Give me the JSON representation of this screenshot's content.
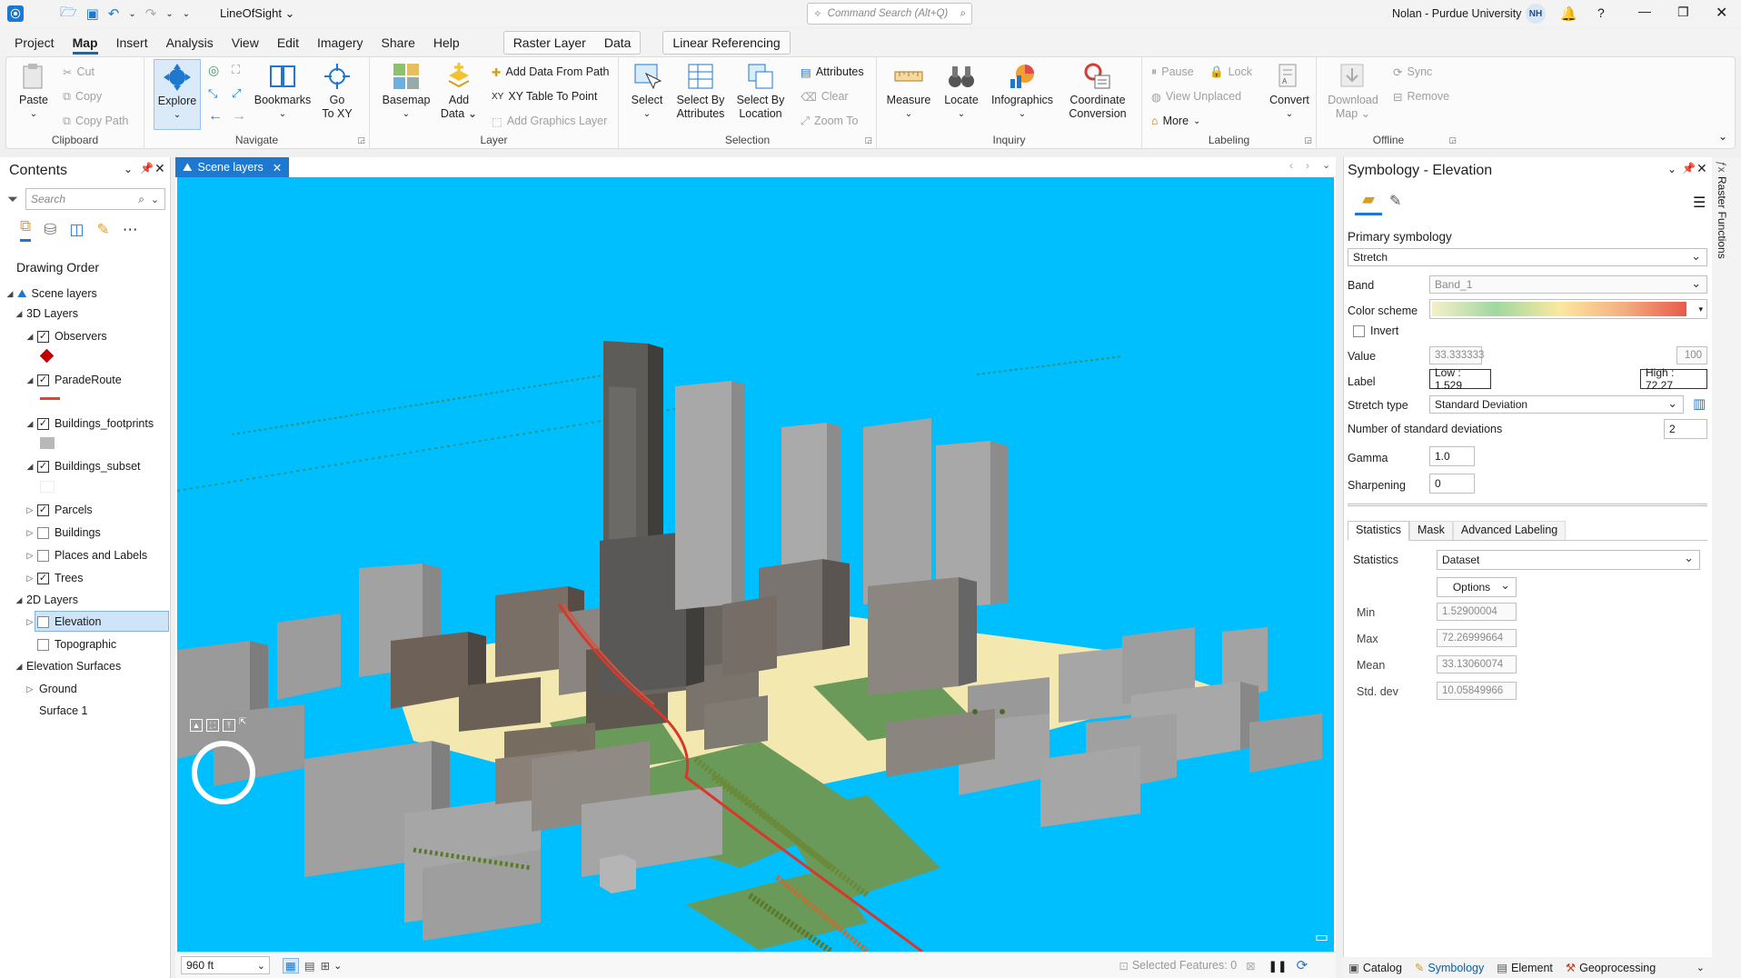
{
  "titlebar": {
    "project_name": "LineOfSight",
    "command_search_placeholder": "Command Search (Alt+Q)",
    "user": "Nolan - Purdue University",
    "user_initials": "NH",
    "help": "?"
  },
  "menu": {
    "tabs": [
      "Project",
      "Map",
      "Insert",
      "Analysis",
      "View",
      "Edit",
      "Imagery",
      "Share",
      "Help"
    ],
    "active_tab": "Map",
    "contextual": [
      "Raster Layer",
      "Data"
    ],
    "linear_referencing": "Linear Referencing"
  },
  "ribbon": {
    "clipboard": {
      "label": "Clipboard",
      "paste": "Paste",
      "cut": "Cut",
      "copy": "Copy",
      "copy_path": "Copy Path"
    },
    "navigate": {
      "label": "Navigate",
      "explore": "Explore",
      "bookmarks": "Bookmarks",
      "go_to_xy_line1": "Go",
      "go_to_xy_line2": "To XY"
    },
    "layer": {
      "label": "Layer",
      "basemap": "Basemap",
      "add_data_line1": "Add",
      "add_data_line2": "Data",
      "add_data_from_path": "Add Data From Path",
      "xy_table_to_point": "XY Table To Point",
      "add_graphics_layer": "Add Graphics Layer"
    },
    "selection": {
      "label": "Selection",
      "select": "Select",
      "select_by_attributes_l1": "Select By",
      "select_by_attributes_l2": "Attributes",
      "select_by_location_l1": "Select By",
      "select_by_location_l2": "Location",
      "attributes": "Attributes",
      "clear": "Clear",
      "zoom_to": "Zoom To"
    },
    "inquiry": {
      "label": "Inquiry",
      "measure": "Measure",
      "locate": "Locate",
      "infographics": "Infographics",
      "coordinate_l1": "Coordinate",
      "coordinate_l2": "Conversion"
    },
    "labeling": {
      "label": "Labeling",
      "pause": "Pause",
      "lock": "Lock",
      "view_unplaced": "View Unplaced",
      "more": "More",
      "convert": "Convert"
    },
    "offline": {
      "label": "Offline",
      "download_l1": "Download",
      "download_l2": "Map",
      "sync": "Sync",
      "remove": "Remove"
    }
  },
  "contents": {
    "title": "Contents",
    "search_placeholder": "Search",
    "drawing_order": "Drawing Order",
    "scene_layers": "Scene layers",
    "group_3d": "3D Layers",
    "observers": "Observers",
    "parade_route": "ParadeRoute",
    "buildings_footprints": "Buildings_footprints",
    "buildings_subset": "Buildings_subset",
    "parcels": "Parcels",
    "buildings": "Buildings",
    "places_and_labels": "Places and Labels",
    "trees": "Trees",
    "group_2d": "2D Layers",
    "elevation": "Elevation",
    "topographic": "Topographic",
    "elevation_surfaces": "Elevation Surfaces",
    "ground": "Ground",
    "surface_1": "Surface 1"
  },
  "map": {
    "tab_label": "Scene layers",
    "scale": "960 ft",
    "selected_features": "Selected Features: 0"
  },
  "symbology": {
    "title": "Symbology - Elevation",
    "primary_symbology": "Primary symbology",
    "renderer": "Stretch",
    "band_label": "Band",
    "band_value": "Band_1",
    "color_scheme_label": "Color scheme",
    "invert": "Invert",
    "value_label": "Value",
    "value_value": "33.333333",
    "value_max": "100",
    "label_label": "Label",
    "low_label": "Low : 1.529",
    "high_label": "High : 72.27",
    "stretch_type_label": "Stretch type",
    "stretch_type_value": "Standard Deviation",
    "num_std_label": "Number of standard deviations",
    "num_std_value": "2",
    "gamma_label": "Gamma",
    "gamma_value": "1.0",
    "sharpening_label": "Sharpening",
    "sharpening_value": "0",
    "tabs": [
      "Statistics",
      "Mask",
      "Advanced Labeling"
    ],
    "statistics_label": "Statistics",
    "statistics_value": "Dataset",
    "options": "Options",
    "min_label": "Min",
    "min_value": "1.52900004",
    "max_label": "Max",
    "max_value": "72.26999664",
    "mean_label": "Mean",
    "mean_value": "33.13060074",
    "std_label": "Std. dev",
    "std_value": "10.05849966"
  },
  "rail": {
    "raster_functions": "Raster Functions"
  },
  "bottom_tabs": [
    "Catalog",
    "Symbology",
    "Element",
    "Geoprocessing"
  ],
  "colors": {
    "accent": "#1e78d0",
    "scene_water": "#00bfff",
    "route": "#e8402a",
    "observer": "#c00000"
  }
}
